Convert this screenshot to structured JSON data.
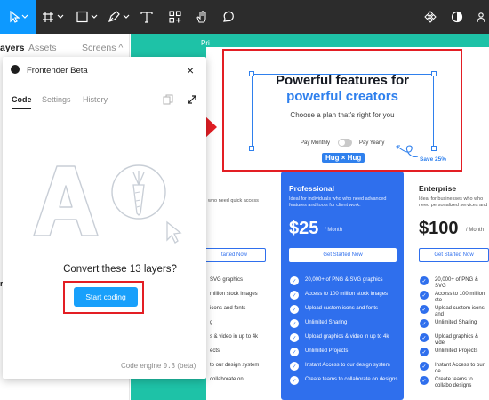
{
  "toolbar": {
    "tools": [
      "move-tool",
      "frame-tool",
      "shape-tool",
      "pen-tool",
      "text-tool",
      "resources-tool",
      "hand-tool",
      "comment-tool"
    ],
    "right_tools": [
      "components-icon",
      "theme-icon",
      "share-icon"
    ]
  },
  "left_panel": {
    "tab_layers": "ayers",
    "tab_assets": "Assets",
    "tab_screens": "Screens ^",
    "clipped_label": "rs"
  },
  "canvas": {
    "frame_label": "Pri",
    "hero": {
      "title": "Powerful features for",
      "subtitle": "powerful creators",
      "description": "Choose a plan that's right for you",
      "toggle_left": "Pay Monthly",
      "toggle_right": "Pay Yearly",
      "hug_badge": "Hug × Hug",
      "save_note": "Save 25%"
    },
    "plans": {
      "basic_partial": {
        "desc": "who need quick access",
        "cta": "tarted Now",
        "features": [
          "SVG graphics",
          "million stock images",
          "icons and fonts",
          "g",
          "s & video in up to 4k",
          "ects",
          "to our design system",
          "collaborate on"
        ]
      },
      "professional": {
        "name": "Professional",
        "desc": "Ideal for individuals who who need advanced features and tools for client work.",
        "price": "$25",
        "per": "/ Month",
        "cta": "Get Started Now",
        "features": [
          "20,000+ of PNG & SVG graphics",
          "Access to 100 million stock images",
          "Upload custom icons and fonts",
          "Unlimited Sharing",
          "Upload graphics & video in up to 4k",
          "Unlimited Projects",
          "Instant Access to our design system",
          "Create teams to collaborate on designs"
        ]
      },
      "enterprise": {
        "name": "Enterprise",
        "desc": "Ideal for businesses who who need personalized services and security for large teams.",
        "price": "$100",
        "per": "/ Month",
        "cta": "Get Started Now",
        "features": [
          "20,000+ of PNG & SVG",
          "Access to 100 million sto",
          "Upload custom icons and",
          "Unlimited Sharing",
          "Upload graphics & vide",
          "Unlimited Projects",
          "Instant Access to our de",
          "Create teams to collabo designs"
        ]
      }
    }
  },
  "plugin": {
    "title": "Frontender Beta",
    "tabs": [
      "Code",
      "Settings",
      "History"
    ],
    "active_tab": "Code",
    "convert_text": "Convert these 13 layers?",
    "start_button": "Start coding",
    "engine_label": "Code engine",
    "engine_version": "0.3",
    "engine_tag": "(beta)"
  },
  "colors": {
    "toolbar_bg": "#2c2c2c",
    "accent": "#0d99ff",
    "frame_teal": "#1ec2a7",
    "plan_blue": "#2f6fed",
    "highlight_red": "#e31e24"
  }
}
